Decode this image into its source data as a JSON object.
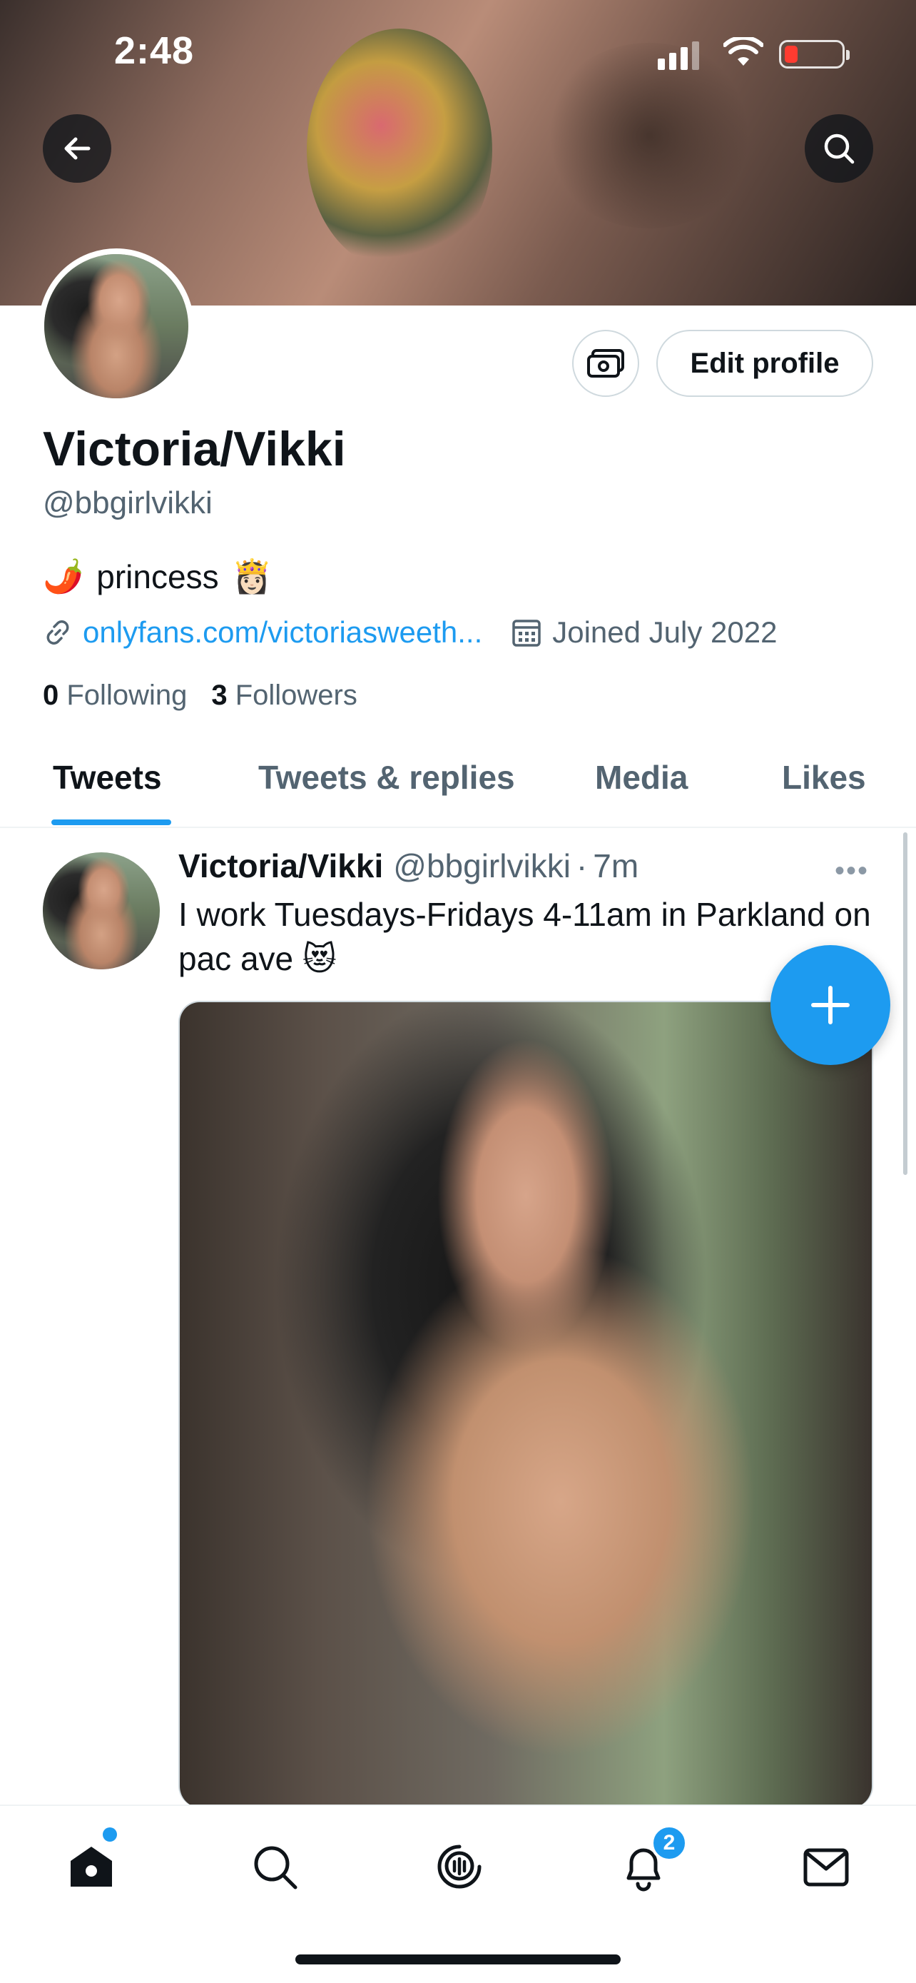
{
  "status_bar": {
    "time": "2:48"
  },
  "profile": {
    "display_name": "Victoria/Vikki",
    "handle": "@bbgirlvikki",
    "bio_text": "princess",
    "bio_emoji_left": "🌶️",
    "bio_emoji_right": "👸🏻",
    "website": "onlyfans.com/victoriasweeth...",
    "joined": "Joined July 2022",
    "following_count": "0",
    "following_label": "Following",
    "followers_count": "3",
    "followers_label": "Followers",
    "edit_profile_label": "Edit profile"
  },
  "tabs": [
    {
      "label": "Tweets",
      "active": true
    },
    {
      "label": "Tweets & replies",
      "active": false
    },
    {
      "label": "Media",
      "active": false
    },
    {
      "label": "Likes",
      "active": false
    }
  ],
  "tweet": {
    "author_name": "Victoria/Vikki",
    "author_handle": "@bbgirlvikki",
    "separator": "·",
    "time": "7m",
    "more": "•••",
    "text": "I work Tuesdays-Fridays 4-11am in Parkland on pac ave",
    "emoji": "😻"
  },
  "bottom_nav": {
    "items": [
      "home-icon",
      "search-icon",
      "spaces-icon",
      "notifications-icon",
      "messages-icon"
    ],
    "notification_badge": "2"
  },
  "colors": {
    "accent": "#1d9bf0",
    "text_primary": "#0f1419",
    "text_secondary": "#536471"
  }
}
